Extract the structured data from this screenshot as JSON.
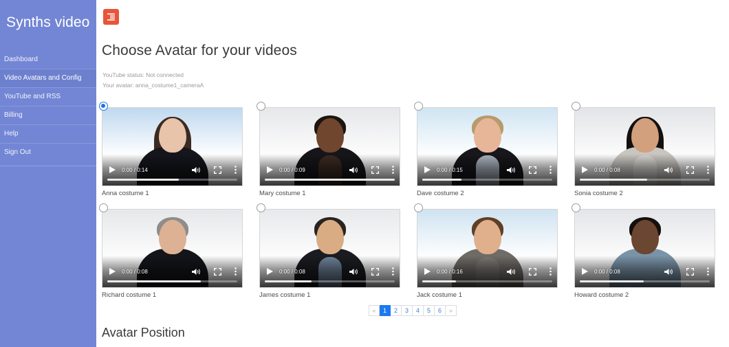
{
  "sidebar": {
    "brand": "Synths video",
    "items": [
      {
        "label": "Dashboard",
        "active": false
      },
      {
        "label": "Video Avatars and Config",
        "active": true
      },
      {
        "label": "YouTube and RSS",
        "active": false
      },
      {
        "label": "Billing",
        "active": false
      },
      {
        "label": "Help",
        "active": false
      },
      {
        "label": "Sign Out",
        "active": false
      }
    ],
    "bg_color": "#7386d5",
    "active_color": "#6d80ce"
  },
  "toolbar": {
    "toggle_icon": "sidebar-toggle-icon",
    "toggle_color": "#e8553a"
  },
  "main": {
    "page_title": "Choose Avatar for your videos",
    "status_youtube": "YouTube status: Not connected",
    "status_avatar": "Your avatar: anna_costume1_cameraA",
    "section_title": "Avatar Position"
  },
  "avatars": [
    {
      "label": "Anna costume 1",
      "time": "0:00 / 0:14",
      "selected": true,
      "progress": 55,
      "bg_top": "#bfd8ef",
      "bg_bottom": "#ffffff",
      "skin": "#e8c4ab",
      "hair": "#3b2a22",
      "hair_style": "long",
      "clothes": "#15161c",
      "shirt": "#15161c"
    },
    {
      "label": "Mary costume 1",
      "time": "0:00 / 0:09",
      "selected": false,
      "progress": 100,
      "bg_top": "#e6e7ea",
      "bg_bottom": "#fdfdfd",
      "skin": "#70462f",
      "hair": "#1c1410",
      "hair_style": "short",
      "clothes": "#16161a",
      "shirt": "#3a2a20"
    },
    {
      "label": "Dave costume 2",
      "time": "0:00 / 0:15",
      "selected": false,
      "progress": 30,
      "bg_top": "#cfe4f2",
      "bg_bottom": "#ffffff",
      "skin": "#e7b699",
      "hair": "#b89a6b",
      "hair_style": "short",
      "clothes": "#17171c",
      "shirt": "#a9b2bd"
    },
    {
      "label": "Sonia costume 2",
      "time": "0:00 / 0:08",
      "selected": false,
      "progress": 52,
      "bg_top": "#e3e4e8",
      "bg_bottom": "#fcfcfc",
      "skin": "#d2a07c",
      "hair": "#14100e",
      "hair_style": "long",
      "clothes": "#c9c6c2",
      "shirt": "#d8d5d1"
    },
    {
      "label": "Richard costume 1",
      "time": "0:00 / 0:08",
      "selected": false,
      "progress": 72,
      "bg_top": "#e6e7ea",
      "bg_bottom": "#fdfdfd",
      "skin": "#ddb193",
      "hair": "#8f8d8a",
      "hair_style": "short",
      "clothes": "#14151a",
      "shirt": "#14151a"
    },
    {
      "label": "James costume 1",
      "time": "0:00 / 0:08",
      "selected": false,
      "progress": 36,
      "bg_top": "#e8e9ec",
      "bg_bottom": "#fdfdfd",
      "skin": "#d9ac84",
      "hair": "#2a2420",
      "hair_style": "short",
      "clothes": "#1b1c21",
      "shirt": "#6d8198"
    },
    {
      "label": "Jack costume 1",
      "time": "0:00 / 0:16",
      "selected": false,
      "progress": 26,
      "bg_top": "#cfe3f1",
      "bg_bottom": "#ffffff",
      "skin": "#e0b08c",
      "hair": "#5e4026",
      "hair_style": "short",
      "clothes": "#6f6b66",
      "shirt": "#7a7570"
    },
    {
      "label": "Howard costume 2",
      "time": "0:00 / 0:08",
      "selected": false,
      "progress": 49,
      "bg_top": "#e4e5e9",
      "bg_bottom": "#fcfcfc",
      "skin": "#6b4630",
      "hair": "#15100d",
      "hair_style": "short",
      "clothes": "#7a93a8",
      "shirt": "#7a93a8"
    }
  ],
  "pagination": {
    "prev": "«",
    "next": "»",
    "pages": [
      "1",
      "2",
      "3",
      "4",
      "5",
      "6"
    ],
    "active_page": "1",
    "active_color": "#1a7af0"
  }
}
